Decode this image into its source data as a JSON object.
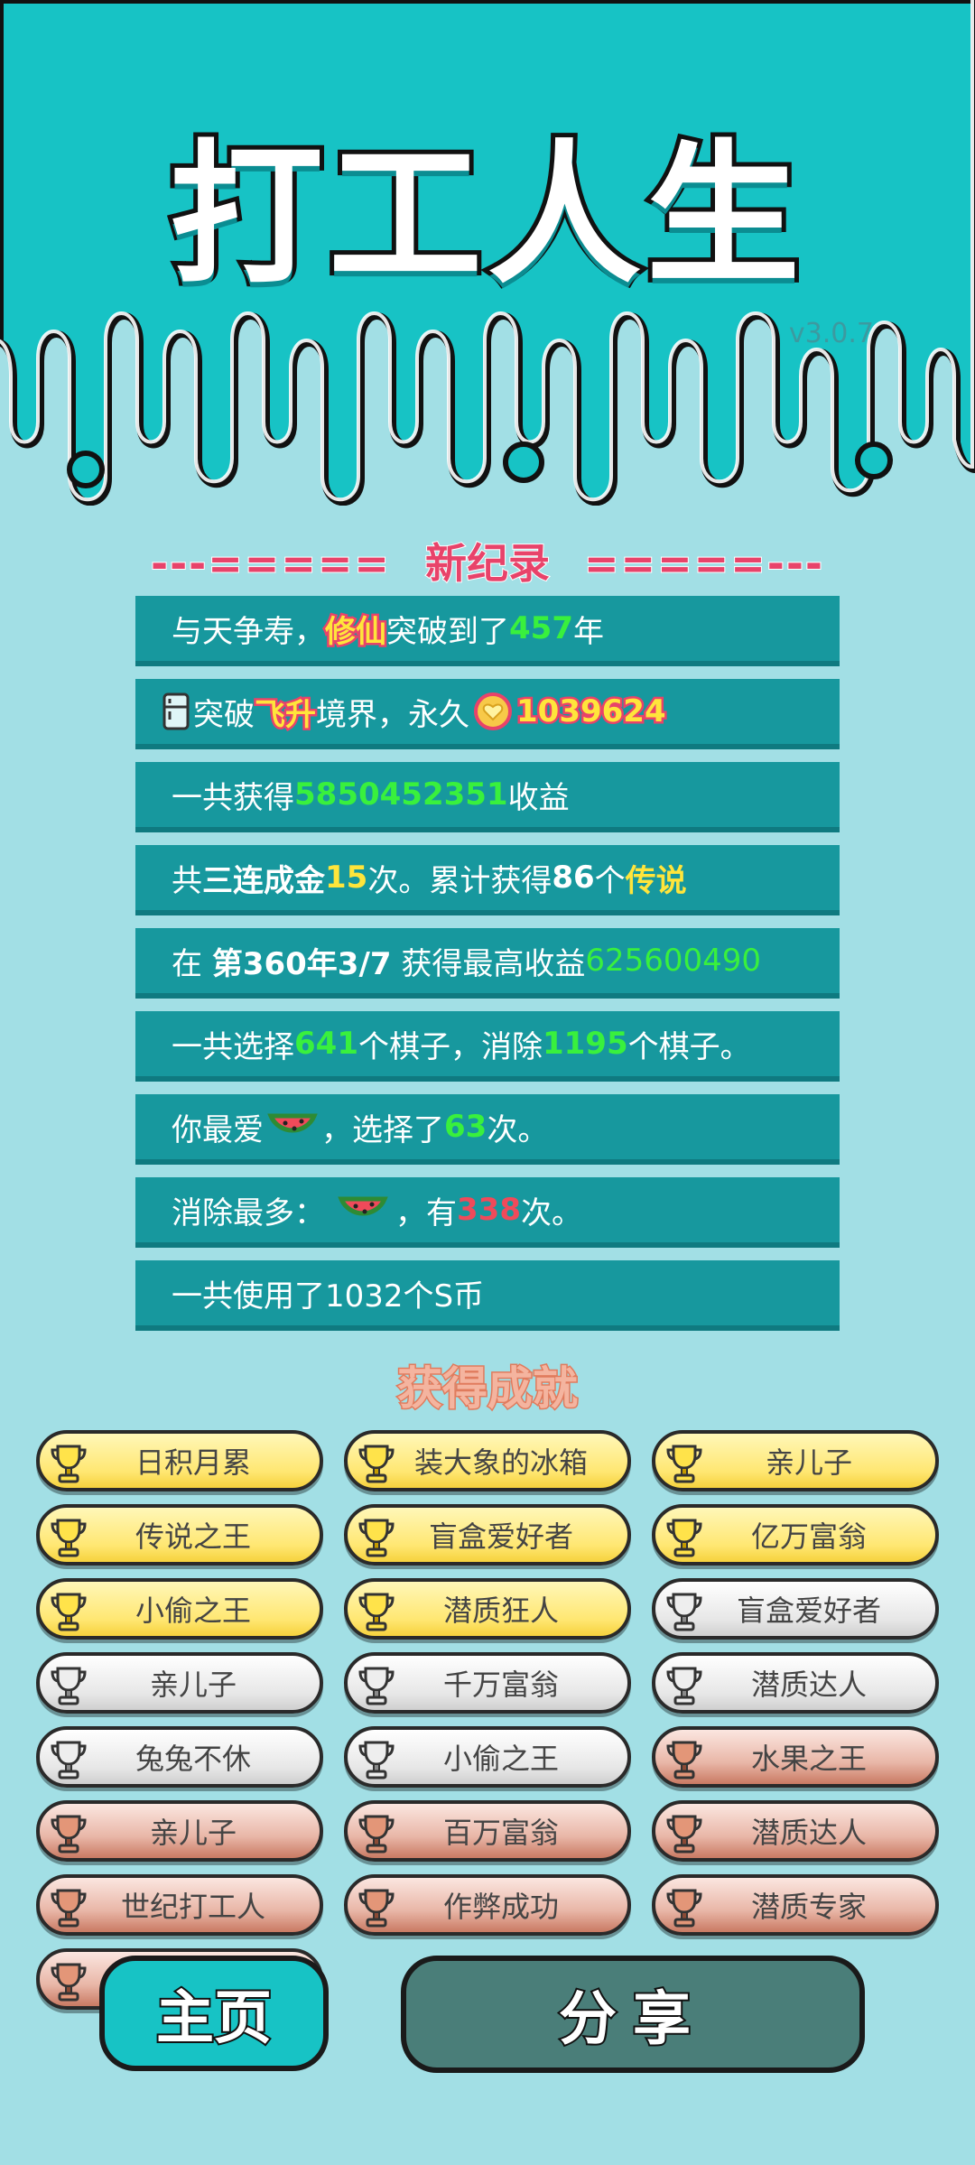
{
  "header": {
    "title": "打工人生",
    "version": "v3.0.7"
  },
  "banner": {
    "left": "---=====",
    "title": "新纪录",
    "right": "=====---"
  },
  "records": [
    {
      "parts": [
        "与天争寿，",
        "修仙",
        "突破到了",
        "457",
        "年"
      ]
    },
    {
      "parts": [
        "突破",
        "飞升",
        "境界，永久",
        "1039624"
      ]
    },
    {
      "parts": [
        "一共获得",
        "5850452351",
        "收益"
      ]
    },
    {
      "parts": [
        "共",
        "三连成金",
        "15",
        "次。累计获得",
        "86",
        "个",
        "传说"
      ]
    },
    {
      "parts": [
        "在 ",
        "第360年3/7",
        " 获得最高收益",
        "625600490"
      ]
    },
    {
      "parts": [
        "一共选择",
        "641",
        "个棋子，消除",
        "1195",
        "个棋子。"
      ]
    },
    {
      "parts": [
        "你最爱",
        "，选择了",
        "63",
        "次。"
      ]
    },
    {
      "parts": [
        "消除最多：",
        "，有",
        "338",
        "次。"
      ]
    },
    {
      "parts": [
        "一共使用了1032个S币"
      ]
    }
  ],
  "achievements_title": "获得成就",
  "achievements": [
    {
      "label": "日积月累",
      "tier": "gold"
    },
    {
      "label": "装大象的冰箱",
      "tier": "gold"
    },
    {
      "label": "亲儿子",
      "tier": "gold"
    },
    {
      "label": "传说之王",
      "tier": "gold"
    },
    {
      "label": "盲盒爱好者",
      "tier": "gold"
    },
    {
      "label": "亿万富翁",
      "tier": "gold"
    },
    {
      "label": "小偷之王",
      "tier": "gold"
    },
    {
      "label": "潜质狂人",
      "tier": "gold"
    },
    {
      "label": "盲盒爱好者",
      "tier": "silver"
    },
    {
      "label": "亲儿子",
      "tier": "silver"
    },
    {
      "label": "千万富翁",
      "tier": "silver"
    },
    {
      "label": "潜质达人",
      "tier": "silver"
    },
    {
      "label": "兔兔不休",
      "tier": "silver"
    },
    {
      "label": "小偷之王",
      "tier": "silver"
    },
    {
      "label": "水果之王",
      "tier": "bronze"
    },
    {
      "label": "亲儿子",
      "tier": "bronze"
    },
    {
      "label": "百万富翁",
      "tier": "bronze"
    },
    {
      "label": "潜质达人",
      "tier": "bronze"
    },
    {
      "label": "世纪打工人",
      "tier": "bronze"
    },
    {
      "label": "作弊成功",
      "tier": "bronze"
    },
    {
      "label": "潜质专家",
      "tier": "bronze"
    },
    {
      "label": "",
      "tier": "bronze"
    }
  ],
  "buttons": {
    "home": "主页",
    "share": "分享"
  },
  "colors": {
    "header_teal": "#17c3c5",
    "background": "#a2dfe5",
    "record_bg": "#17989e",
    "accent_pink": "#e8436a"
  }
}
